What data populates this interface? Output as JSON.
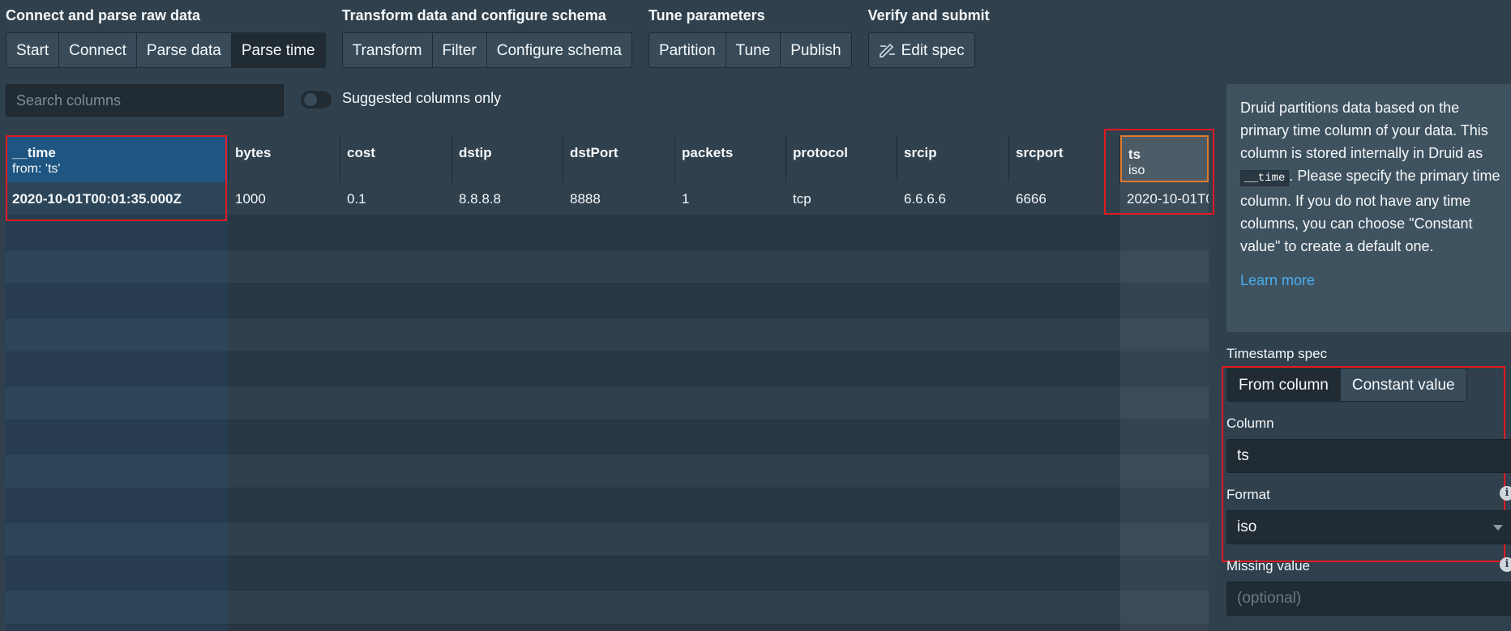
{
  "steps": [
    {
      "title": "Connect and parse raw data",
      "buttons": [
        "Start",
        "Connect",
        "Parse data",
        "Parse time"
      ],
      "active": 3
    },
    {
      "title": "Transform data and configure schema",
      "buttons": [
        "Transform",
        "Filter",
        "Configure schema"
      ]
    },
    {
      "title": "Tune parameters",
      "buttons": [
        "Partition",
        "Tune",
        "Publish"
      ]
    },
    {
      "title": "Verify and submit",
      "buttons": [
        "Edit spec"
      ]
    }
  ],
  "search": {
    "placeholder": "Search columns"
  },
  "toggle": {
    "label": "Suggested columns only",
    "on": false
  },
  "table": {
    "columns": [
      {
        "name": "__time",
        "sub": "from: 'ts'"
      },
      {
        "name": "bytes",
        "sub": ""
      },
      {
        "name": "cost",
        "sub": ""
      },
      {
        "name": "dstip",
        "sub": ""
      },
      {
        "name": "dstPort",
        "sub": ""
      },
      {
        "name": "packets",
        "sub": ""
      },
      {
        "name": "protocol",
        "sub": ""
      },
      {
        "name": "srcip",
        "sub": ""
      },
      {
        "name": "srcport",
        "sub": ""
      },
      {
        "name": "ts",
        "sub": "iso"
      }
    ],
    "rows": [
      [
        "2020-10-01T00:01:35.000Z",
        "1000",
        "0.1",
        "8.8.8.8",
        "8888",
        "1",
        "tcp",
        "6.6.6.6",
        "6666",
        "2020-10-01T0"
      ]
    ]
  },
  "panel": {
    "info_before": "Druid partitions data based on the primary time column of your data. This column is stored internally in Druid as ",
    "info_code": "__time",
    "info_after": ". Please specify the primary time column. If you do not have any time columns, you can choose \"Constant value\" to create a default one.",
    "learn_more": "Learn more",
    "timestamp_spec_label": "Timestamp spec",
    "spec_options": [
      "From column",
      "Constant value"
    ],
    "column_label": "Column",
    "column_value": "ts",
    "format_label": "Format",
    "format_value": "iso",
    "missing_label": "Missing value",
    "missing_placeholder": "(optional)",
    "info_glyph": "i"
  },
  "colors": {
    "time_header": "#1f5581",
    "highlight": "#e01a22",
    "link": "#48aff0",
    "selected_col_border": "#e07a2f"
  },
  "icons": {
    "edit_spec": "edit-spec-icon",
    "info": "info-icon",
    "dropdown": "caret-down-icon"
  }
}
